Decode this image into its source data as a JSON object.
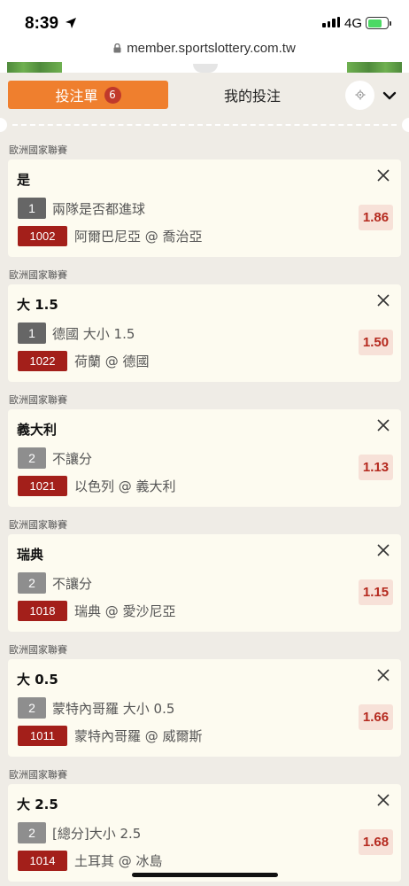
{
  "status_bar": {
    "time": "8:39",
    "network": "4G",
    "battery_color": "#4cd964"
  },
  "browser": {
    "url": "member.sportslottery.com.tw"
  },
  "tabs": {
    "bet_slip_label": "投注單",
    "bet_slip_count": "6",
    "my_bets_label": "我的投注"
  },
  "colors": {
    "accent": "#ef7f2e",
    "match_badge": "#a31f1a",
    "odds_text": "#b52a1f",
    "odds_bg": "#f7e1d8"
  },
  "bets": [
    {
      "league": "歐洲國家聯賽",
      "selection": "是",
      "bet_type": "1",
      "market": "兩隊是否都進球",
      "match_no": "1002",
      "teams": "阿爾巴尼亞 @ 喬治亞",
      "odds": "1.86"
    },
    {
      "league": "歐洲國家聯賽",
      "selection": "大 1.5",
      "bet_type": "1",
      "market": "德國 大小 1.5",
      "match_no": "1022",
      "teams": "荷蘭 @ 德國",
      "odds": "1.50"
    },
    {
      "league": "歐洲國家聯賽",
      "selection": "義大利",
      "bet_type": "2",
      "market": "不讓分",
      "match_no": "1021",
      "teams": "以色列 @ 義大利",
      "odds": "1.13"
    },
    {
      "league": "歐洲國家聯賽",
      "selection": "瑞典",
      "bet_type": "2",
      "market": "不讓分",
      "match_no": "1018",
      "teams": "瑞典 @ 愛沙尼亞",
      "odds": "1.15"
    },
    {
      "league": "歐洲國家聯賽",
      "selection": "大 0.5",
      "bet_type": "2",
      "market": "蒙特內哥羅 大小 0.5",
      "match_no": "1011",
      "teams": "蒙特內哥羅 @ 威爾斯",
      "odds": "1.66"
    },
    {
      "league": "歐洲國家聯賽",
      "selection": "大 2.5",
      "bet_type": "2",
      "market": "[總分]大小 2.5",
      "match_no": "1014",
      "teams": "土耳其 @ 冰島",
      "odds": "1.68"
    }
  ]
}
